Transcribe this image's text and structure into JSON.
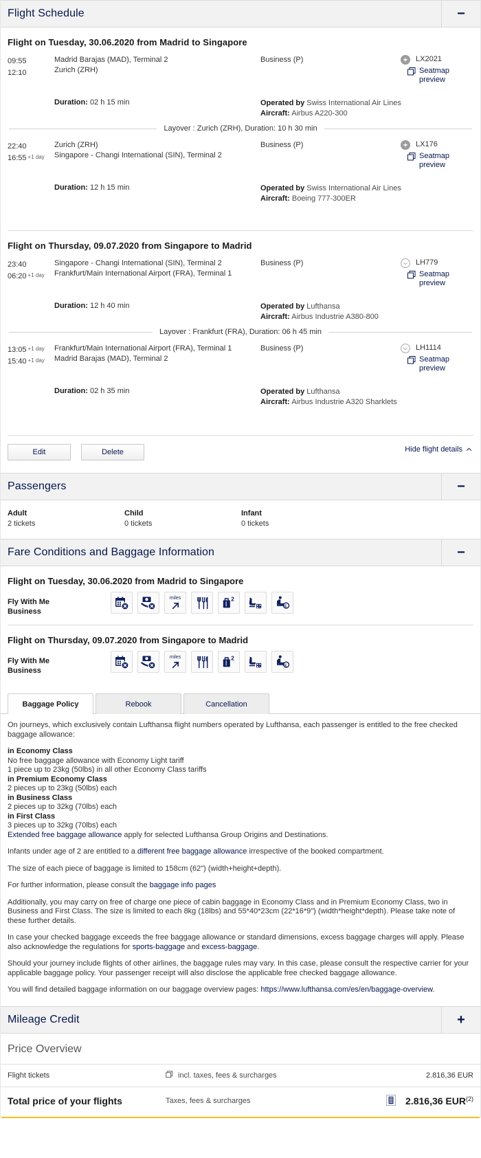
{
  "sections": {
    "flight_schedule": {
      "title": "Flight Schedule",
      "toggle": "−"
    },
    "passengers": {
      "title": "Passengers",
      "toggle": "−"
    },
    "fare": {
      "title": "Fare Conditions and Baggage Information",
      "toggle": "−"
    },
    "mileage": {
      "title": "Mileage Credit",
      "toggle": "+"
    },
    "price": {
      "title": "Price Overview"
    }
  },
  "outbound": {
    "heading": "Flight on Tuesday, 30.06.2020 from Madrid to Singapore",
    "legs": [
      {
        "dep_time": "09:55",
        "dep_plus": "",
        "arr_time": "12:10",
        "arr_plus": "",
        "dep_airport": "Madrid Barajas (MAD), Terminal 2",
        "arr_airport": "Zurich (ZRH)",
        "cabin": "Business (P)",
        "duration_label": "Duration:",
        "duration_value": "02 h 15 min",
        "operated_label": "Operated by",
        "operated_value": "Swiss International Air Lines",
        "aircraft_label": "Aircraft:",
        "aircraft_value": "Airbus A220-300",
        "flight_no": "LX2021",
        "airline_logo": "swiss-logo-icon",
        "seatmap_label": "Seatmap preview"
      },
      {
        "dep_time": "22:40",
        "dep_plus": "",
        "arr_time": "16:55",
        "arr_plus": "+1 day",
        "dep_airport": "Zurich (ZRH)",
        "arr_airport": "Singapore - Changi International (SIN), Terminal 2",
        "cabin": "Business (P)",
        "duration_label": "Duration:",
        "duration_value": "12 h 15 min",
        "operated_label": "Operated by",
        "operated_value": "Swiss International Air Lines",
        "aircraft_label": "Aircraft:",
        "aircraft_value": "Boeing 777-300ER",
        "flight_no": "LX176",
        "airline_logo": "swiss-logo-icon",
        "seatmap_label": "Seatmap preview"
      }
    ],
    "layover": "Layover   : Zurich (ZRH), Duration: 10 h 30 min"
  },
  "inbound": {
    "heading": "Flight on Thursday, 09.07.2020 from Singapore to Madrid",
    "legs": [
      {
        "dep_time": "23:40",
        "dep_plus": "",
        "arr_time": "06:20",
        "arr_plus": "+1 day",
        "dep_airport": "Singapore - Changi International (SIN), Terminal 2",
        "arr_airport": "Frankfurt/Main International Airport (FRA), Terminal 1",
        "cabin": "Business (P)",
        "duration_label": "Duration:",
        "duration_value": "12 h 40 min",
        "operated_label": "Operated by",
        "operated_value": "Lufthansa",
        "aircraft_label": "Aircraft:",
        "aircraft_value": "Airbus Industrie A380-800",
        "flight_no": "LH779",
        "airline_logo": "lufthansa-logo-icon",
        "seatmap_label": "Seatmap preview"
      },
      {
        "dep_time": "13:05",
        "dep_plus": "+1 day",
        "arr_time": "15:40",
        "arr_plus": "+1 day",
        "dep_airport": "Frankfurt/Main International Airport (FRA), Terminal 1",
        "arr_airport": "Madrid Barajas (MAD), Terminal 2",
        "cabin": "Business (P)",
        "duration_label": "Duration:",
        "duration_value": "02 h 35 min",
        "operated_label": "Operated by",
        "operated_value": "Lufthansa",
        "aircraft_label": "Aircraft:",
        "aircraft_value": "Airbus Industrie A320 Sharklets",
        "flight_no": "LH1114",
        "airline_logo": "lufthansa-logo-icon",
        "seatmap_label": "Seatmap preview"
      }
    ],
    "layover": "Layover   : Frankfurt (FRA), Duration: 06 h 45 min"
  },
  "actions": {
    "edit": "Edit",
    "delete": "Delete",
    "hide_details": "Hide flight details",
    "caret": "⌃"
  },
  "passengers": [
    {
      "label": "Adult",
      "value": "2 tickets"
    },
    {
      "label": "Child",
      "value": "0 tickets"
    },
    {
      "label": "Infant",
      "value": "0 tickets"
    }
  ],
  "fare_conditions": [
    {
      "heading": "Flight on Tuesday, 30.06.2020 from Madrid to Singapore",
      "fare_name_line1": "Fly With Me",
      "fare_name_line2": "Business",
      "icons": [
        "rebooking-not-allowed-icon",
        "refund-not-allowed-icon",
        "miles-earning-icon",
        "catering-icon",
        "checked-baggage-2-icon",
        "seat-reservation-icon",
        "paid-seat-reservation-icon"
      ],
      "miles_text": "miles",
      "baggage_count": "2"
    },
    {
      "heading": "Flight on Thursday, 09.07.2020 from Singapore to Madrid",
      "fare_name_line1": "Fly With Me",
      "fare_name_line2": "Business",
      "icons": [
        "rebooking-not-allowed-icon",
        "refund-not-allowed-icon",
        "miles-earning-icon",
        "catering-icon",
        "checked-baggage-2-icon",
        "seat-reservation-icon",
        "paid-seat-reservation-icon"
      ],
      "miles_text": "miles",
      "baggage_count": "2"
    }
  ],
  "tabs": [
    {
      "label": "Baggage Policy",
      "active": true
    },
    {
      "label": "Rebook",
      "active": false
    },
    {
      "label": "Cancellation",
      "active": false
    }
  ],
  "baggage_policy": {
    "intro": "On journeys, which exclusively contain Lufthansa flight numbers operated by Lufthansa, each passenger is entitled to the free checked baggage allowance:",
    "economy_head": "in Economy Class",
    "economy_l1": "No free baggage allowance with Economy Light tariff",
    "economy_l2": "1 piece up to 23kg (50lbs) in all other Economy Class tariffs",
    "premium_head": "in Premium Economy Class",
    "premium_l1": "2 pieces up to 23kg (50lbs) each",
    "business_head": "in Business Class",
    "business_l1": "2 pieces up to 32kg (70lbs) each",
    "first_head": "in First Class",
    "first_l1": "3 pieces up to 32kg (70lbs) each",
    "extended_link": "Extended free baggage allowance",
    "extended_rest": " apply for selected Lufthansa Group Origins and Destinations.",
    "infants_pre": "Infants under age of 2 are entitled to a ",
    "infants_link": "different free baggage allowance",
    "infants_post": " irrespective of the booked compartment.",
    "size_line": "The size of each piece of baggage is limited to 158cm (62\") (width+height+depth).",
    "further_pre": "For further information, please consult the ",
    "further_link": "baggage info pages",
    "cabin_para": "Additionally, you may carry on free of charge one piece of cabin baggage in Economy Class and in Premium Economy Class, two in Business and First Class. The size is limited to each 8kg (18lbs) and 55*40*23cm (22*16*9\") (width*height*depth). Please take note of these further details.",
    "excess_pre": "In case your checked baggage exceeds the free baggage allowance or standard dimensions, excess baggage charges will apply. Please also acknowledge the regulations for ",
    "excess_link1": "sports-baggage",
    "excess_mid": " and ",
    "excess_link2": "excess-baggage",
    "excess_post": ".",
    "other_airlines": "Should your journey include flights of other airlines, the baggage rules may vary. In this case, please consult the respective carrier for your applicable baggage policy. Your passenger receipt will also disclose the applicable free checked baggage allowance.",
    "overview_pre": "You will find detailed baggage information on our baggage overview pages: ",
    "overview_link": "https://www.lufthansa.com/es/en/baggage-overview",
    "overview_post": "."
  },
  "price_overview": {
    "row_label": "Flight tickets",
    "row_mid": "incl. taxes, fees & surcharges",
    "row_amount": "2.816,36 EUR",
    "total_label": "Total price of your flights",
    "total_mid": "Taxes, fees & surcharges",
    "total_amount": "2.816,36 EUR",
    "total_sup": "(2)"
  }
}
